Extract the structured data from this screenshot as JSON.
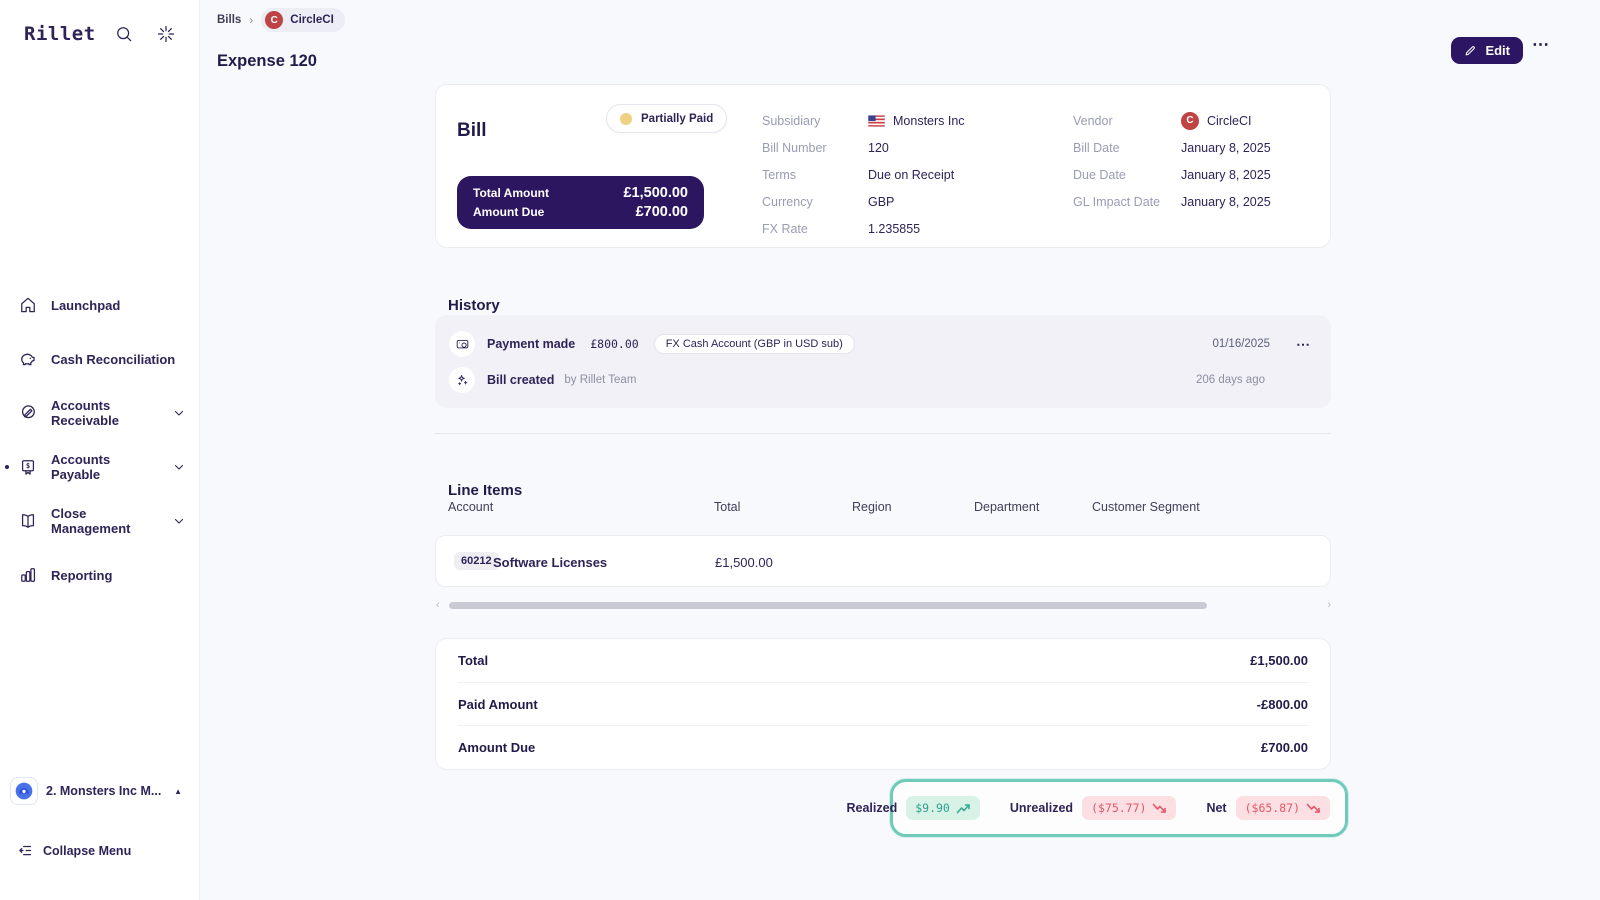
{
  "colors": {
    "brand_purple": "#2d1660",
    "status_yellow": "#f0d082",
    "positive_green": "#2aa188",
    "negative_red": "#e4566a",
    "highlight_teal": "#6fcab8",
    "vendor_red": "#bf4342"
  },
  "topbar": {
    "logo": "Rillet"
  },
  "sidebar": {
    "items": [
      {
        "label": "Launchpad"
      },
      {
        "label": "Cash Reconciliation"
      },
      {
        "label": "Accounts Receivable"
      },
      {
        "label": "Accounts Payable"
      },
      {
        "label": "Close Management"
      },
      {
        "label": "Reporting"
      }
    ],
    "workspace": {
      "label": "2. Monsters Inc M...",
      "caret": "▲"
    },
    "collapse_label": "Collapse Menu"
  },
  "header": {
    "breadcrumb_root": "Bills",
    "breadcrumb_chevron": "›",
    "breadcrumb_avatar_letter": "C",
    "breadcrumb_current": "CircleCI",
    "title": "Expense 120",
    "edit_label": "Edit",
    "more_label": "⋯"
  },
  "bill": {
    "card_title": "Bill",
    "status": "Partially Paid",
    "summary": {
      "total_label": "Total Amount",
      "total_value": "£1,500.00",
      "due_label": "Amount Due",
      "due_value": "£700.00"
    },
    "details_left": [
      {
        "label": "Subsidiary",
        "value": "Monsters Inc"
      },
      {
        "label": "Bill Number",
        "value": "120"
      },
      {
        "label": "Terms",
        "value": "Due on Receipt"
      },
      {
        "label": "Currency",
        "value": "GBP"
      },
      {
        "label": "FX Rate",
        "value": "1.235855"
      }
    ],
    "details_right": [
      {
        "label": "Vendor",
        "value": "CircleCI",
        "avatar_letter": "C"
      },
      {
        "label": "Bill Date",
        "value": "January 8, 2025"
      },
      {
        "label": "Due Date",
        "value": "January 8, 2025"
      },
      {
        "label": "GL Impact Date",
        "value": "January 8, 2025"
      }
    ]
  },
  "history": {
    "title": "History",
    "events": [
      {
        "label": "Payment made",
        "amount": "£800.00",
        "tag": "FX Cash Account (GBP in USD sub)",
        "meta": "01/16/2025",
        "menu": "⋯"
      },
      {
        "label": "Bill created",
        "by": "by Rillet Team",
        "meta": "206 days ago"
      }
    ]
  },
  "line_items": {
    "title": "Line Items",
    "columns": [
      "Account",
      "Total",
      "Region",
      "Department",
      "Customer Segment"
    ],
    "rows": [
      {
        "account_code": "60212",
        "account_name": "Software Licenses",
        "total": "£1,500.00",
        "region": "",
        "department": "",
        "customer_segment": ""
      }
    ],
    "scrollbar": {
      "left_arrow": "‹",
      "right_arrow": "›"
    }
  },
  "totals": {
    "rows": [
      {
        "label": "Total",
        "value": "£1,500.00"
      },
      {
        "label": "Paid Amount",
        "value": "-£800.00"
      },
      {
        "label": "Amount Due",
        "value": "£700.00"
      }
    ]
  },
  "fx_summary": {
    "realized_label": "Realized",
    "realized_value": "$9.90",
    "unrealized_label": "Unrealized",
    "unrealized_value": "($75.77)",
    "net_label": "Net",
    "net_value": "($65.87)"
  }
}
